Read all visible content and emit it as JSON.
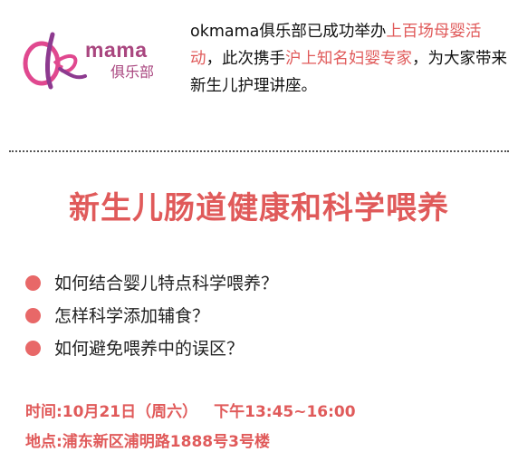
{
  "logo": {
    "word": "mama",
    "cn": "俱乐部",
    "colors": {
      "pink": "#e0488f",
      "purple": "#8d3a8f"
    }
  },
  "intro": {
    "segments": [
      {
        "text": "okmama俱乐部已成功举办",
        "highlight": false
      },
      {
        "text": "上百场母婴活动",
        "highlight": true
      },
      {
        "text": "，此次携手",
        "highlight": false
      },
      {
        "text": "沪上知名妇婴专家",
        "highlight": true
      },
      {
        "text": "，为大家带来新生儿护理讲座。",
        "highlight": false
      }
    ]
  },
  "headline": "新生儿肠道健康和科学喂养",
  "topics": [
    "如何结合婴儿特点科学喂养？",
    "怎样科学添加辅食？",
    "如何避免喂养中的误区？"
  ],
  "info": {
    "time_label": "时间:10月21日（周六）",
    "time_range": "下午13:45~16:00",
    "place": "地点:浦东新区浦明路1888号3号楼"
  },
  "colors": {
    "accent": "#e05a5a",
    "bullet": "#e86868",
    "text": "#111111"
  }
}
